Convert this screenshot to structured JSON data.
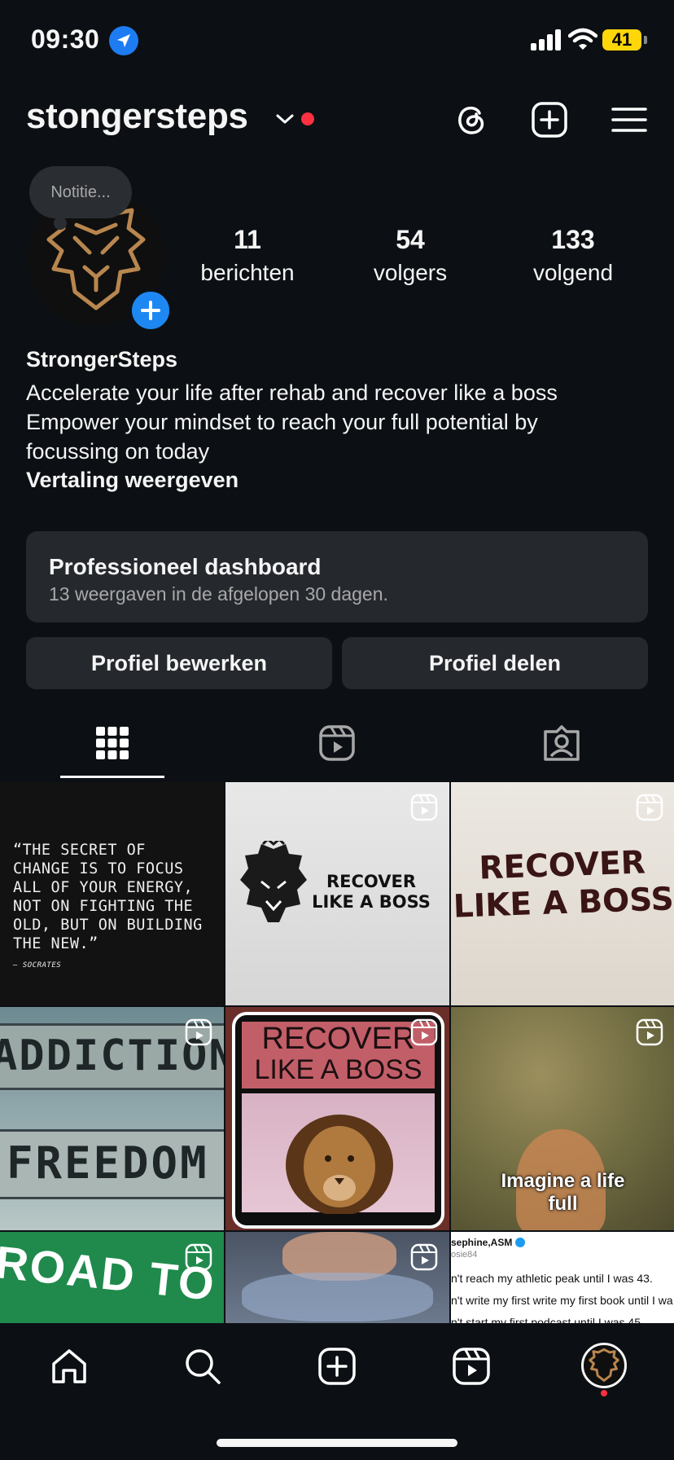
{
  "status": {
    "time": "09:30",
    "battery": "41"
  },
  "header": {
    "username": "stongersteps"
  },
  "profile": {
    "note": "Notitie...",
    "stats": [
      {
        "num": "11",
        "label": "berichten"
      },
      {
        "num": "54",
        "label": "volgers"
      },
      {
        "num": "133",
        "label": "volgend"
      }
    ],
    "name": "StrongerSteps",
    "bio": [
      "Accelerate your life after rehab and recover like a boss",
      "Empower your mindset to reach your full potential by",
      "focussing on today"
    ],
    "translate": "Vertaling weergeven"
  },
  "dashboard": {
    "title": "Professioneel dashboard",
    "subtitle": "13 weergaven in de afgelopen 30 dagen."
  },
  "buttons": {
    "edit": "Profiel bewerken",
    "share": "Profiel delen"
  },
  "grid": {
    "quote": [
      "“THE SECRET OF",
      "CHANGE IS TO FOCUS",
      "ALL OF YOUR ENERGY,",
      "NOT ON FIGHTING THE",
      "OLD, BUT ON BUILDING",
      "THE NEW.”"
    ],
    "quote_author": "— SOCRATES",
    "t2": [
      "RECOVER",
      "LIKE A BOSS"
    ],
    "t3": [
      "RECOVER",
      "LIKE A BOSS"
    ],
    "t4": [
      "ADDICTION",
      "FREEDOM"
    ],
    "t5": [
      "RECOVER",
      "LIKE A BOSS"
    ],
    "t6": [
      "Imagine a life",
      "full"
    ],
    "t7": "ROAD TO",
    "t9_handle": "sephine,ASM",
    "t9_sub": "osie84",
    "t9_lines": [
      "n't reach my athletic peak until I was 43.",
      "n't write my first write my first book until I wa",
      "n't start my first podcast until I was 45"
    ]
  },
  "colors": {
    "bg": "#0c1014",
    "accent": "#1e88f2",
    "notify": "#ff3040",
    "battery": "#ffd60a"
  }
}
